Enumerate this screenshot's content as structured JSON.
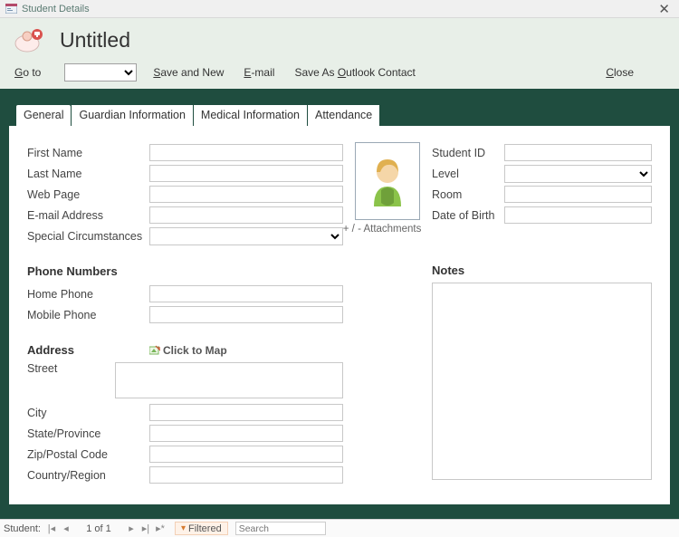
{
  "window": {
    "title": "Student Details",
    "close_char": "✕"
  },
  "header": {
    "title": "Untitled"
  },
  "commands": {
    "goto_prefix": "G",
    "goto_label": "o to",
    "save_and_new_u": "S",
    "save_and_new_rest": "ave and New",
    "email_u": "E",
    "email_rest": "-mail",
    "save_outlook_pre": "Save As ",
    "save_outlook_u": "O",
    "save_outlook_rest": "utlook Contact",
    "close_u": "C",
    "close_rest": "lose"
  },
  "tabs": {
    "general": "General",
    "guardian": "Guardian Information",
    "medical": "Medical Information",
    "attendance": "Attendance"
  },
  "labels": {
    "first_name": "First Name",
    "last_name": "Last Name",
    "web_page": "Web Page",
    "email": "E-mail Address",
    "special": "Special Circumstances",
    "student_id": "Student ID",
    "level": "Level",
    "room": "Room",
    "dob": "Date of Birth",
    "attachments": "+ / -  Attachments",
    "phone_section": "Phone Numbers",
    "home_phone": "Home Phone",
    "mobile_phone": "Mobile Phone",
    "notes_section": "Notes",
    "address_section": "Address",
    "click_to_map": "Click to Map",
    "street": "Street",
    "city": "City",
    "state": "State/Province",
    "zip": "Zip/Postal Code",
    "country": "Country/Region"
  },
  "values": {
    "first_name": "",
    "last_name": "",
    "web_page": "",
    "email": "",
    "special": "",
    "student_id": "",
    "level": "",
    "room": "",
    "dob": "",
    "home_phone": "",
    "mobile_phone": "",
    "street": "",
    "city": "",
    "state": "",
    "zip": "",
    "country": "",
    "notes": ""
  },
  "recnav": {
    "label": "Student:",
    "first": "|◂",
    "prev": "◂",
    "position": "1 of 1",
    "next": "▸",
    "last": "▸|",
    "new": "▸*",
    "filtered": "Filtered",
    "search_placeholder": "Search"
  }
}
